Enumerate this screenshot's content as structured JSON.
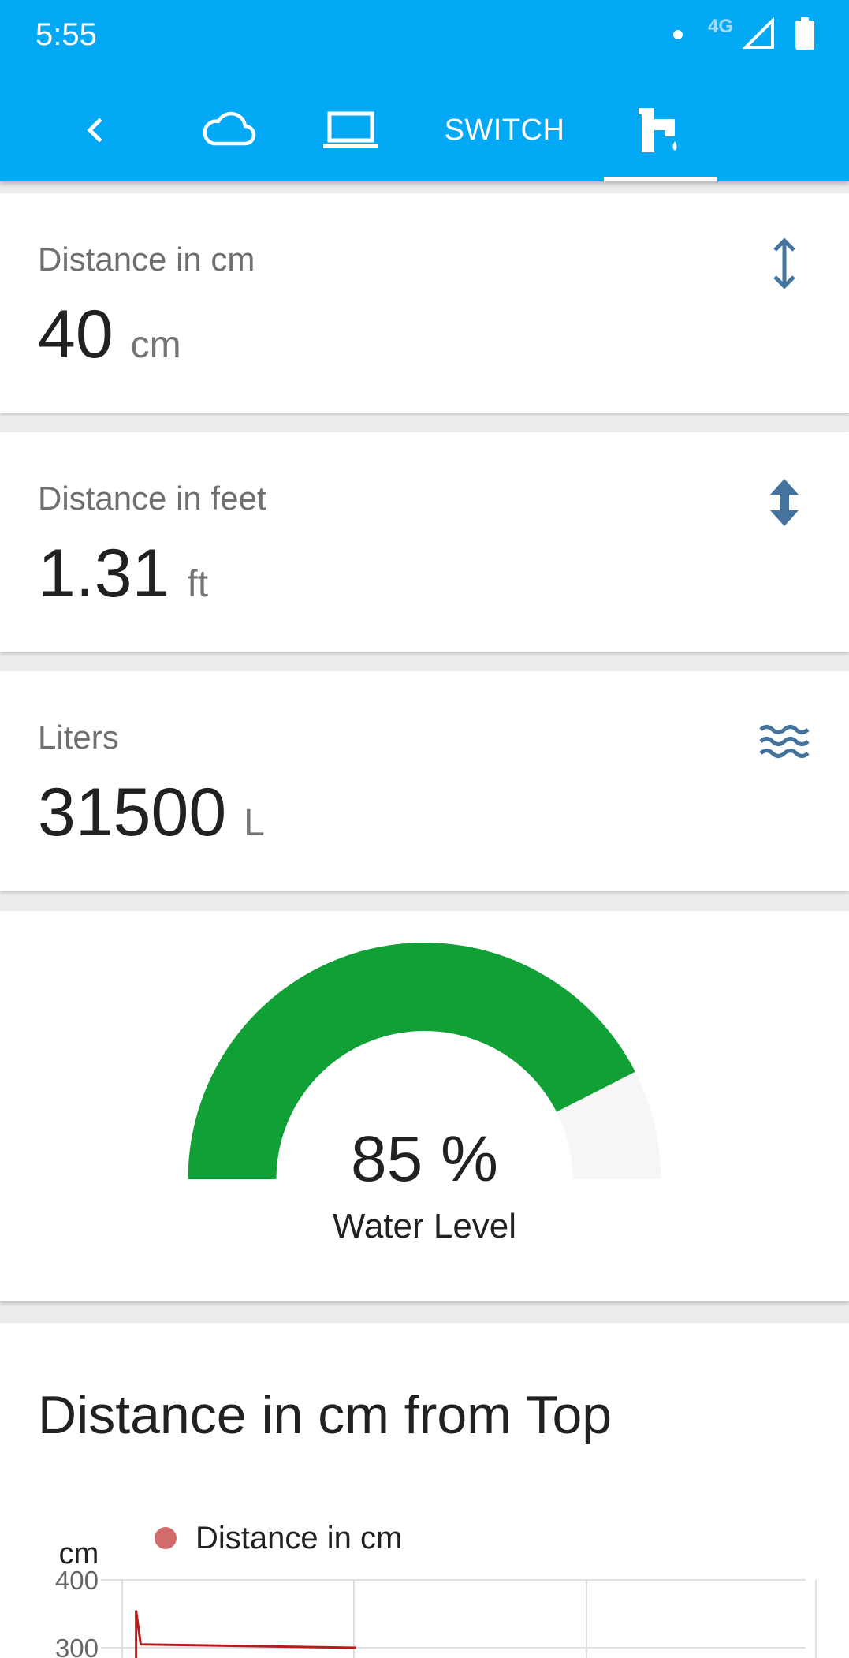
{
  "status_bar": {
    "time": "5:55",
    "network": "4G"
  },
  "tabs": [
    {
      "icon": "chevron-left-icon"
    },
    {
      "icon": "cloud-icon"
    },
    {
      "icon": "laptop-icon"
    },
    {
      "label": "SWITCH"
    },
    {
      "icon": "water-tap-icon",
      "selected": true
    }
  ],
  "cards": [
    {
      "title": "Distance in cm",
      "value": "40",
      "unit": "cm",
      "icon": "arrow-up-down-icon"
    },
    {
      "title": "Distance in feet",
      "value": "1.31",
      "unit": "ft",
      "icon": "arrow-up-down-bold-icon"
    },
    {
      "title": "Liters",
      "value": "31500",
      "unit": "L",
      "icon": "waves-icon"
    }
  ],
  "gauge": {
    "value": 85,
    "value_text": "85 %",
    "label": "Water Level",
    "fill_color": "#10a036",
    "track_color": "#f6f6f6"
  },
  "chart": {
    "title": "Distance in cm from Top"
  },
  "chart_data": {
    "type": "line",
    "title": "Distance in cm from Top",
    "ylabel": "cm",
    "legend": "top",
    "series": [
      {
        "name": "Distance in cm",
        "color": "#d06c6c",
        "x": [
          0.06,
          0.08,
          1.01
        ],
        "y": [
          355,
          305,
          300
        ]
      }
    ],
    "y_ticks": [
      "400",
      "300"
    ],
    "ylim": [
      0,
      400
    ],
    "grid": true
  },
  "colors": {
    "header": "#03a9f4",
    "icon_blue": "#44739e"
  }
}
